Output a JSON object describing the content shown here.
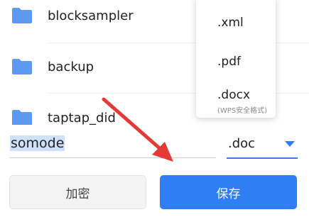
{
  "folders": [
    {
      "name": "blocksampler",
      "icon": "folder-icon"
    },
    {
      "name": "backup",
      "icon": "folder-icon"
    },
    {
      "name": "taptap_did",
      "icon": "folder-icon"
    }
  ],
  "filename": {
    "value": "somode"
  },
  "format_select": {
    "selected": ".doc",
    "icon": "triangle-down-icon"
  },
  "format_dropdown": {
    "items": [
      {
        "label": ".xml"
      },
      {
        "label": ".pdf"
      },
      {
        "label": ".docx",
        "sublabel": "(WPS安全格式)"
      }
    ]
  },
  "buttons": {
    "encrypt_label": "加密",
    "save_label": "保存"
  },
  "colors": {
    "accent": "#2f7ef3",
    "folder": "#5b9af0",
    "annotation": "#e53935"
  }
}
